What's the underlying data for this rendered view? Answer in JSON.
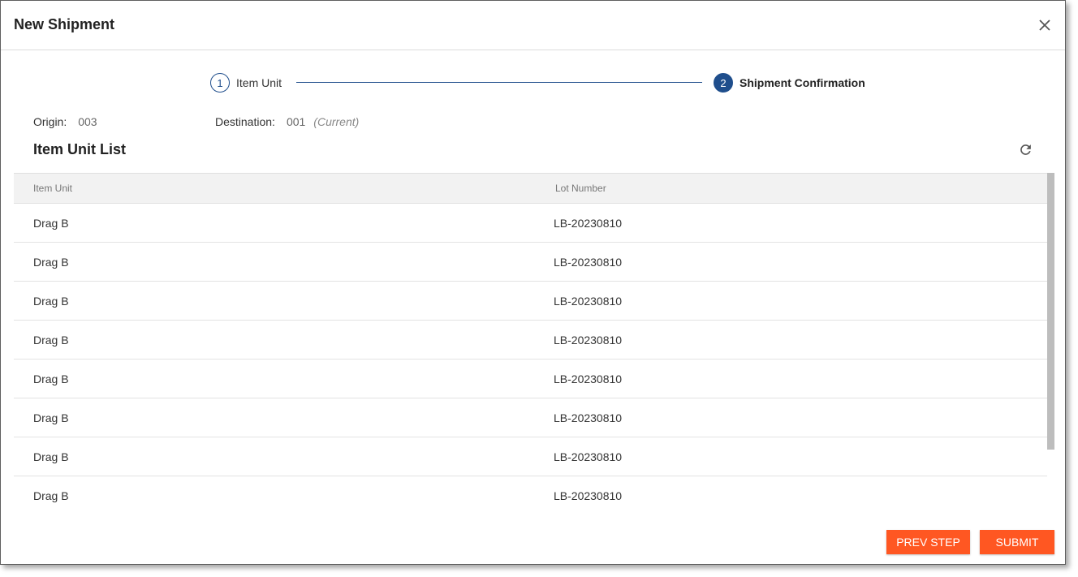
{
  "dialog": {
    "title": "New Shipment"
  },
  "stepper": {
    "steps": [
      {
        "number": "1",
        "label": "Item Unit",
        "state": "completed"
      },
      {
        "number": "2",
        "label": "Shipment Confirmation",
        "state": "active"
      }
    ]
  },
  "info": {
    "origin_label": "Origin:",
    "origin_value": "003",
    "destination_label": "Destination:",
    "destination_value": "001",
    "destination_note": "(Current)"
  },
  "list": {
    "title": "Item Unit List",
    "columns": [
      "Item Unit",
      "Lot Number"
    ],
    "rows": [
      {
        "item_unit": "Drag B",
        "lot_number": "LB-20230810"
      },
      {
        "item_unit": "Drag B",
        "lot_number": "LB-20230810"
      },
      {
        "item_unit": "Drag B",
        "lot_number": "LB-20230810"
      },
      {
        "item_unit": "Drag B",
        "lot_number": "LB-20230810"
      },
      {
        "item_unit": "Drag B",
        "lot_number": "LB-20230810"
      },
      {
        "item_unit": "Drag B",
        "lot_number": "LB-20230810"
      },
      {
        "item_unit": "Drag B",
        "lot_number": "LB-20230810"
      },
      {
        "item_unit": "Drag B",
        "lot_number": "LB-20230810"
      }
    ]
  },
  "footer": {
    "prev_label": "PREV STEP",
    "submit_label": "SUBMIT"
  },
  "colors": {
    "accent": "#ff5722",
    "stepper": "#1f4e8c"
  },
  "icons": {
    "close": "close-icon",
    "refresh": "refresh-icon"
  }
}
